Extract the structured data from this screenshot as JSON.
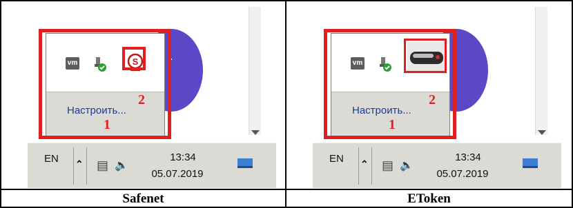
{
  "panels": [
    {
      "caption": "Safenet",
      "settings_label": "Настроить...",
      "marker1": "1",
      "marker2": "2",
      "tray_icons": [
        "vmware-icon",
        "usb-safe-remove-icon",
        "safenet-icon"
      ],
      "taskbar": {
        "language": "EN",
        "time": "13:34",
        "date": "05.07.2019"
      }
    },
    {
      "caption": "EToken",
      "settings_label": "Настроить...",
      "marker1": "1",
      "marker2": "2",
      "tray_icons": [
        "vmware-icon",
        "usb-safe-remove-icon",
        "etoken-usb-icon"
      ],
      "taskbar": {
        "language": "EN",
        "time": "13:34",
        "date": "05.07.2019"
      }
    }
  ],
  "colors": {
    "highlight": "#e02020",
    "link": "#1b3a9a",
    "taskbar": "#dcdad5",
    "accent_circle": "#5a48c7"
  }
}
